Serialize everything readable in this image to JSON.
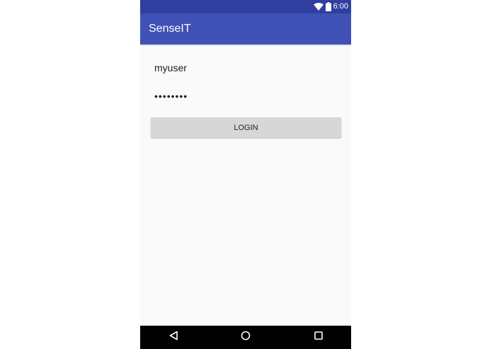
{
  "status_bar": {
    "time": "6:00",
    "icons": [
      "wifi-icon",
      "battery-icon"
    ],
    "color": "#303f9f"
  },
  "app_bar": {
    "title": "SenseIT",
    "color": "#3f51b5"
  },
  "login_form": {
    "username_value": "myuser",
    "password_value": "••••••••",
    "login_label": "LOGIN"
  },
  "nav_bar": {
    "icons": [
      "back-icon",
      "home-icon",
      "recents-icon"
    ]
  }
}
